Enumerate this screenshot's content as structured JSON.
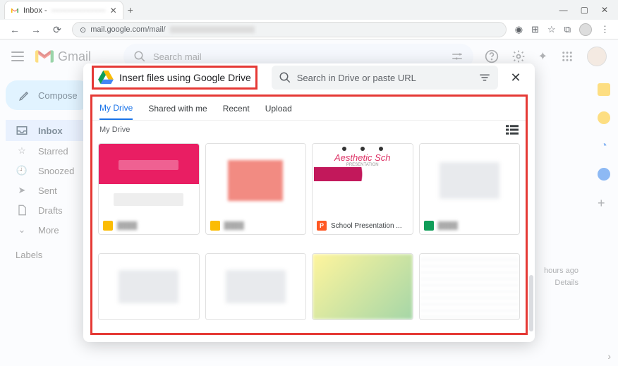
{
  "browser": {
    "tab_title": "Inbox -",
    "tab_title_blur": "———————",
    "url_prefix": "mail.google.com/mail/"
  },
  "gmail": {
    "brand": "Gmail",
    "search_placeholder": "Search mail",
    "compose_label": "Compose",
    "nav": {
      "inbox": "Inbox",
      "starred": "Starred",
      "snoozed": "Snoozed",
      "sent": "Sent",
      "drafts": "Drafts",
      "more": "More"
    },
    "labels_heading": "Labels",
    "meta": {
      "age": "hours ago",
      "details": "Details"
    }
  },
  "picker": {
    "title": "Insert files using Google Drive",
    "search_placeholder": "Search in Drive or paste URL",
    "tabs": {
      "my_drive": "My Drive",
      "shared": "Shared with me",
      "recent": "Recent",
      "upload": "Upload"
    },
    "breadcrumb": "My Drive",
    "files": [
      {
        "id": "f1",
        "label": "",
        "type": "slides",
        "thumb": "pink"
      },
      {
        "id": "f2",
        "label": "",
        "type": "slides",
        "thumb": "pinkbox"
      },
      {
        "id": "f3",
        "label": "School Presentation ...",
        "type": "pres",
        "thumb": "aesthetic",
        "aesthetic_title": "Aesthetic Sch",
        "aesthetic_sub": "PRESENTATION"
      },
      {
        "id": "f4",
        "label": "",
        "type": "sheets",
        "thumb": "grey"
      },
      {
        "id": "f5",
        "label": "",
        "type": "slides",
        "thumb": "grey"
      },
      {
        "id": "f6",
        "label": "",
        "type": "slides",
        "thumb": "grey"
      },
      {
        "id": "f7",
        "label": "",
        "type": "slides",
        "thumb": "yellow"
      },
      {
        "id": "f8",
        "label": "",
        "type": "sheets",
        "thumb": "table"
      }
    ]
  }
}
